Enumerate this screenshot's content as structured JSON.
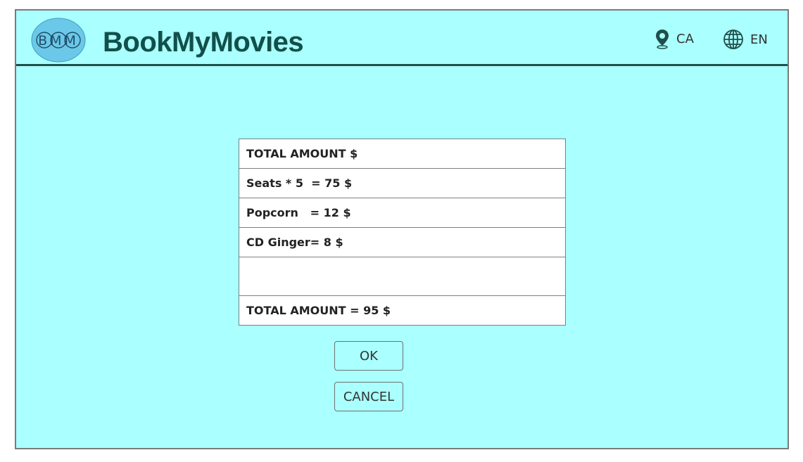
{
  "app": {
    "logo_text": "BMM",
    "brand_name": "BookMyMovies"
  },
  "header": {
    "region": "CA",
    "language": "EN"
  },
  "summary": {
    "rows": [
      "TOTAL AMOUNT $",
      "Seats * 5  = 75 $",
      "Popcorn   = 12 $",
      "CD Ginger= 8 $",
      "",
      "TOTAL AMOUNT = 95 $"
    ]
  },
  "actions": {
    "ok_label": "OK",
    "cancel_label": "CANCEL"
  },
  "colors": {
    "background": "#aaffff",
    "brand": "#11504a",
    "logo_fill": "#6cc8e8"
  },
  "icons": {
    "region": "location-pin-icon",
    "language": "globe-icon"
  }
}
